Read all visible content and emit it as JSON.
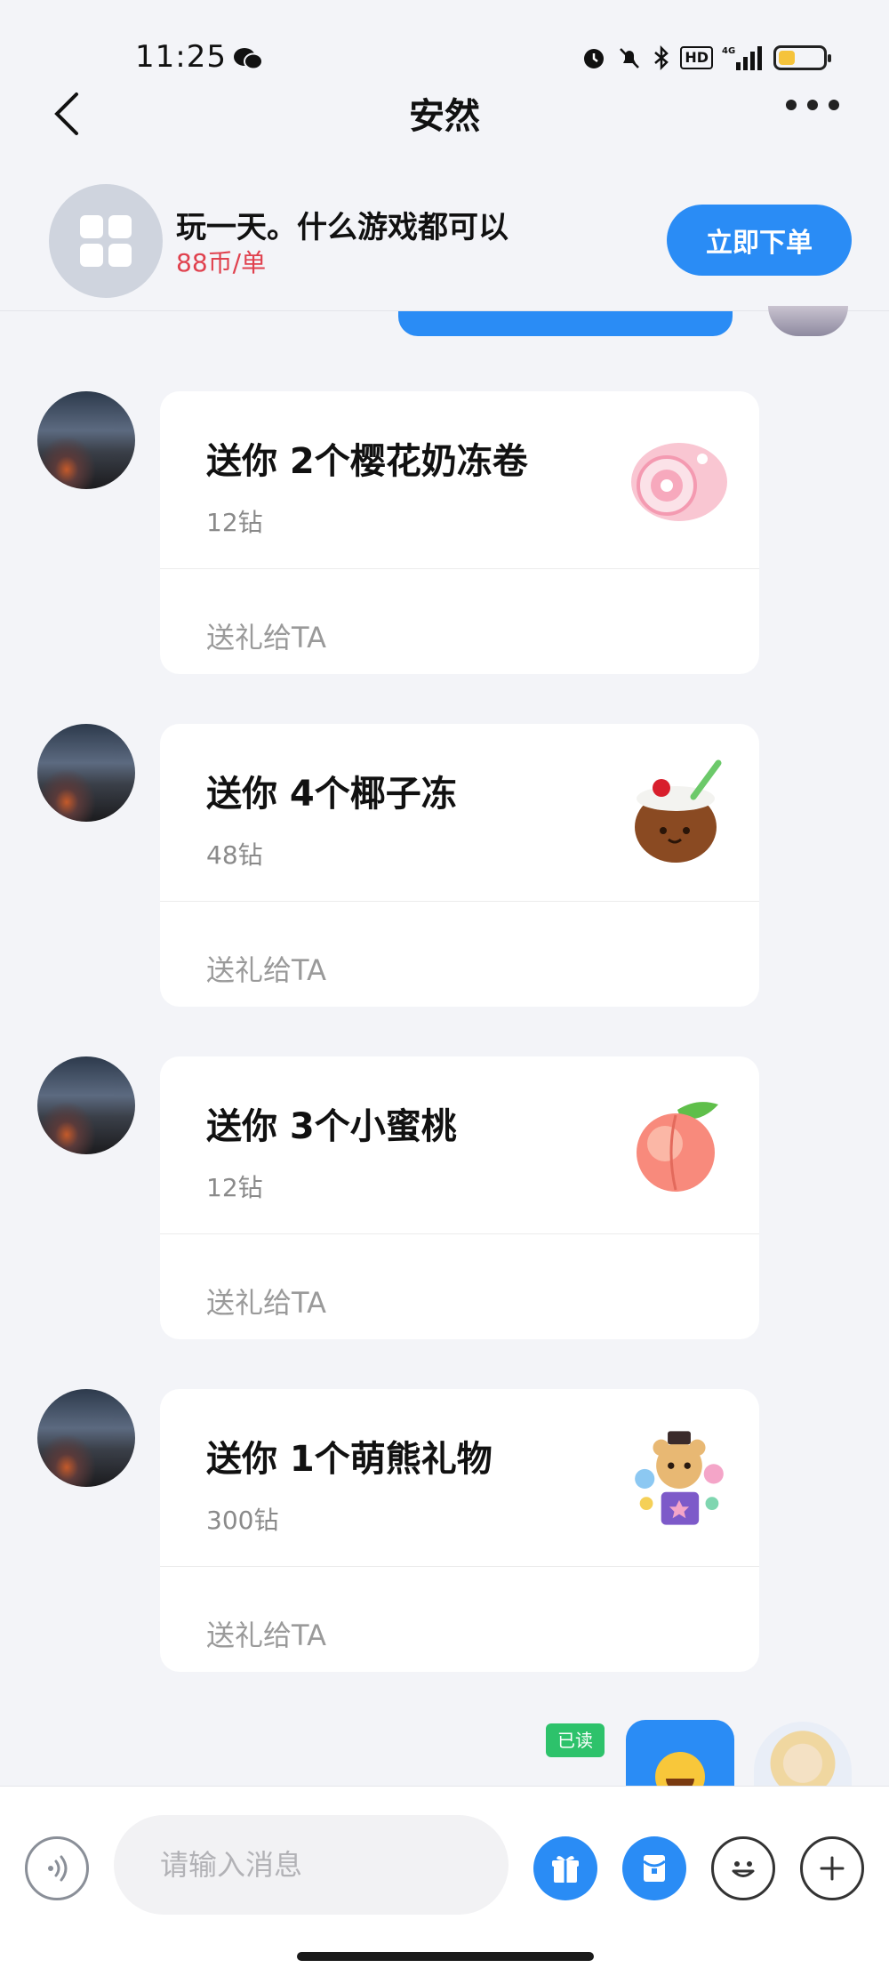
{
  "status_bar": {
    "time": "11:25",
    "network": "4G",
    "hd": "HD",
    "battery_level": 0.3,
    "icons": [
      "wechat-icon",
      "alarm-icon",
      "mute-icon",
      "bluetooth-icon",
      "hd-icon",
      "signal-icon",
      "battery-icon"
    ]
  },
  "nav": {
    "title": "安然",
    "back_icon": "back-arrow-icon",
    "more_icon": "more-dots-icon"
  },
  "order_banner": {
    "title": "玩一天。什么游戏都可以",
    "price": "88币/单",
    "button_label": "立即下单",
    "icon": "service-grid-icon"
  },
  "gifts": [
    {
      "title": "送你 2个樱花奶冻卷",
      "price": "12钻",
      "action": "送礼给TA",
      "image": "sakura-roll-cake-icon"
    },
    {
      "title": "送你 4个椰子冻",
      "price": "48钻",
      "action": "送礼给TA",
      "image": "coconut-jelly-icon"
    },
    {
      "title": "送你 3个小蜜桃",
      "price": "12钻",
      "action": "送礼给TA",
      "image": "peach-icon"
    },
    {
      "title": "送你 1个萌熊礼物",
      "price": "300钻",
      "action": "送礼给TA",
      "image": "cute-bear-gift-icon"
    }
  ],
  "outgoing": {
    "read_label": "已读",
    "emoji": "smiling-face-emoji"
  },
  "input_bar": {
    "placeholder": "请输入消息",
    "icons": [
      "voice-icon",
      "gift-icon",
      "red-packet-icon",
      "emoji-icon",
      "plus-icon"
    ]
  },
  "colors": {
    "accent": "#2a8cf5",
    "price_red": "#e0414e",
    "read_green": "#2dc26b",
    "background": "#f3f4f8"
  }
}
